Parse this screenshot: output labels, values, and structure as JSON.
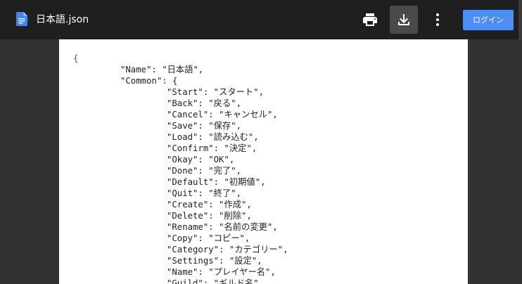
{
  "header": {
    "file_title": "日本語.json",
    "login_label": "ログイン",
    "icons": [
      "document-icon",
      "print-icon",
      "download-icon",
      "more-vert-icon"
    ],
    "colors": {
      "bar": "#1f1f1f",
      "login": "#4d8ef5",
      "doc_icon": "#4285f4"
    }
  },
  "document": {
    "lines": [
      "{",
      "\"Name\": \"日本語\",",
      "\"Common\": {",
      "\"Start\": \"スタート\",",
      "\"Back\": \"戻る\",",
      "\"Cancel\": \"キャンセル\",",
      "\"Save\": \"保存\",",
      "\"Load\": \"読み込む\",",
      "\"Confirm\": \"決定\",",
      "\"Okay\": \"OK\",",
      "\"Done\": \"完了\",",
      "\"Default\": \"初期値\",",
      "\"Quit\": \"終了\",",
      "\"Create\": \"作成\",",
      "\"Delete\": \"削除\",",
      "\"Rename\": \"名前の変更\",",
      "\"Copy\": \"コピー\",",
      "\"Category\": \"カテゴリー\",",
      "\"Settings\": \"設定\",",
      "\"Name\": \"プレイヤー名\",",
      "\"Guild\": \"ギルド名\","
    ]
  }
}
